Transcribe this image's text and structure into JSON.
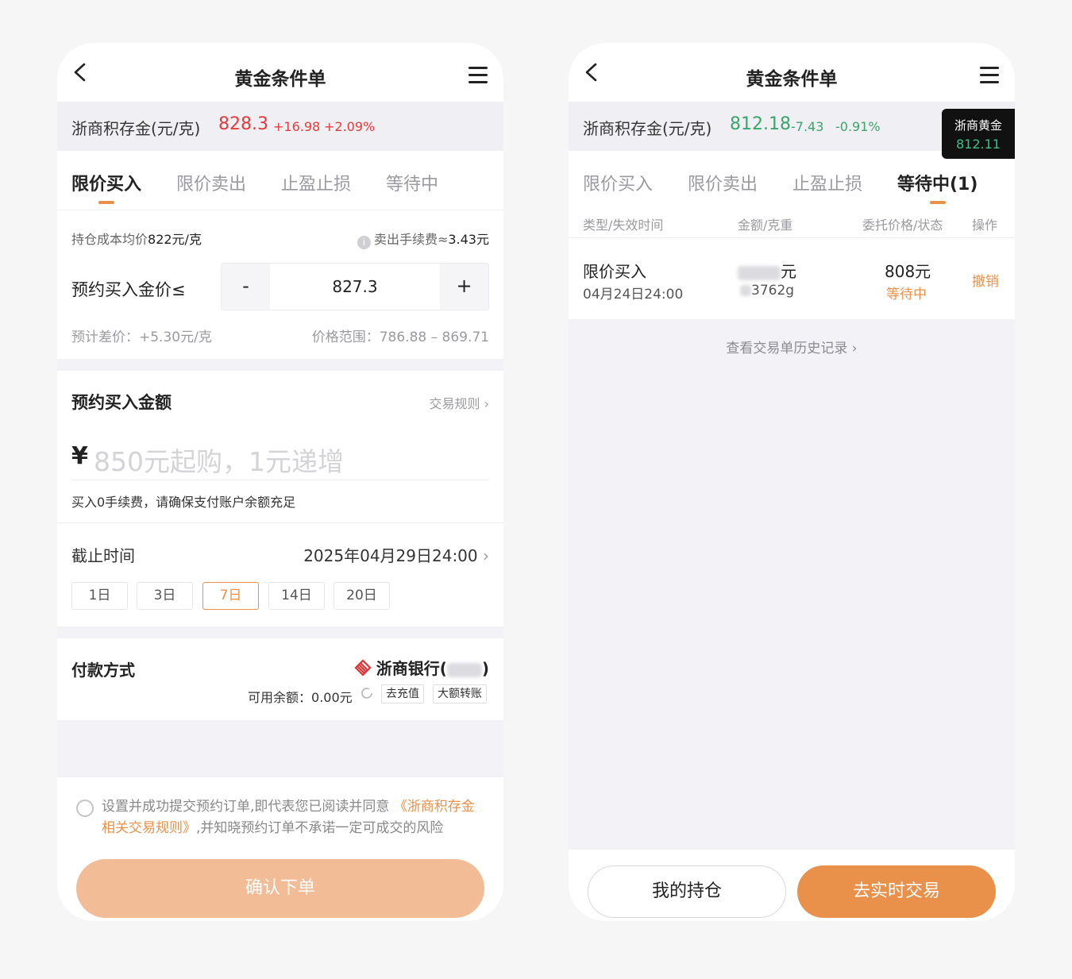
{
  "colors": {
    "accent": "#e9914a",
    "up": "#e83a3a",
    "down": "#3aa56a"
  },
  "left": {
    "nav": {
      "title": "黄金条件单"
    },
    "ticker": {
      "name": "浙商积存金(元/克)",
      "price": "828.3",
      "change": "+16.98",
      "change_pct": "+2.09%"
    },
    "tabs": [
      {
        "label": "限价买入",
        "active": true
      },
      {
        "label": "限价卖出",
        "active": false
      },
      {
        "label": "止盈止损",
        "active": false
      },
      {
        "label": "等待中",
        "active": false
      }
    ],
    "price_section": {
      "cost_label": "持仓成本均价",
      "cost_value": "822元/克",
      "fee_label": "卖出手续费≈",
      "fee_value": "3.43元",
      "order_label": "预约买入金价≤",
      "minus": "-",
      "stepper_value": "827.3",
      "plus": "+",
      "diff": "预计差价：+5.30元/克",
      "range": "价格范围：786.88 – 869.71"
    },
    "amount_section": {
      "title": "预约买入金额",
      "rules_link": "交易规则",
      "currency": "¥",
      "placeholder": "850元起购，1元递增",
      "note": "买入0手续费，请确保支付账户余额充足",
      "deadline_label": "截止时间",
      "deadline_value": "2025年04月29日24:00",
      "durations": [
        {
          "label": "1日",
          "selected": false
        },
        {
          "label": "3日",
          "selected": false
        },
        {
          "label": "7日",
          "selected": true
        },
        {
          "label": "14日",
          "selected": false
        },
        {
          "label": "20日",
          "selected": false
        }
      ]
    },
    "payment": {
      "label": "付款方式",
      "bank_prefix": "浙商银行(",
      "bank_suffix": ")",
      "balance_label": "可用余额：",
      "balance_value": "0.00元",
      "recharge": "去充值",
      "transfer": "大额转账"
    },
    "agreement": {
      "text1": "设置并成功提交预约订单,即代表您已阅读并同意",
      "link": "《浙商积存金相关交易规则》",
      "text2": ",并知晓预约订单不承诺一定可成交的风险"
    },
    "confirm": "确认下单"
  },
  "right": {
    "nav": {
      "title": "黄金条件单"
    },
    "ticker": {
      "name": "浙商积存金(元/克)",
      "price": "812.18",
      "change": "-7.43",
      "change_pct": "-0.91%"
    },
    "tooltip": {
      "title": "浙商黄金",
      "value": "812.11"
    },
    "tabs": [
      {
        "label": "限价买入",
        "active": false
      },
      {
        "label": "限价卖出",
        "active": false
      },
      {
        "label": "止盈止损",
        "active": false
      },
      {
        "label": "等待中(1)",
        "active": true
      }
    ],
    "table_headers": [
      "类型/失效时间",
      "金额/克重",
      "委托价格/状态",
      "操作"
    ],
    "order": {
      "type": "限价买入",
      "expire": "04月24日24:00",
      "amount_unit": "元",
      "weight": "3762g",
      "price": "808元",
      "status": "等待中",
      "action": "撤销"
    },
    "history_link": "查看交易单历史记录",
    "btn_positions": "我的持仓",
    "btn_realtime": "去实时交易"
  }
}
